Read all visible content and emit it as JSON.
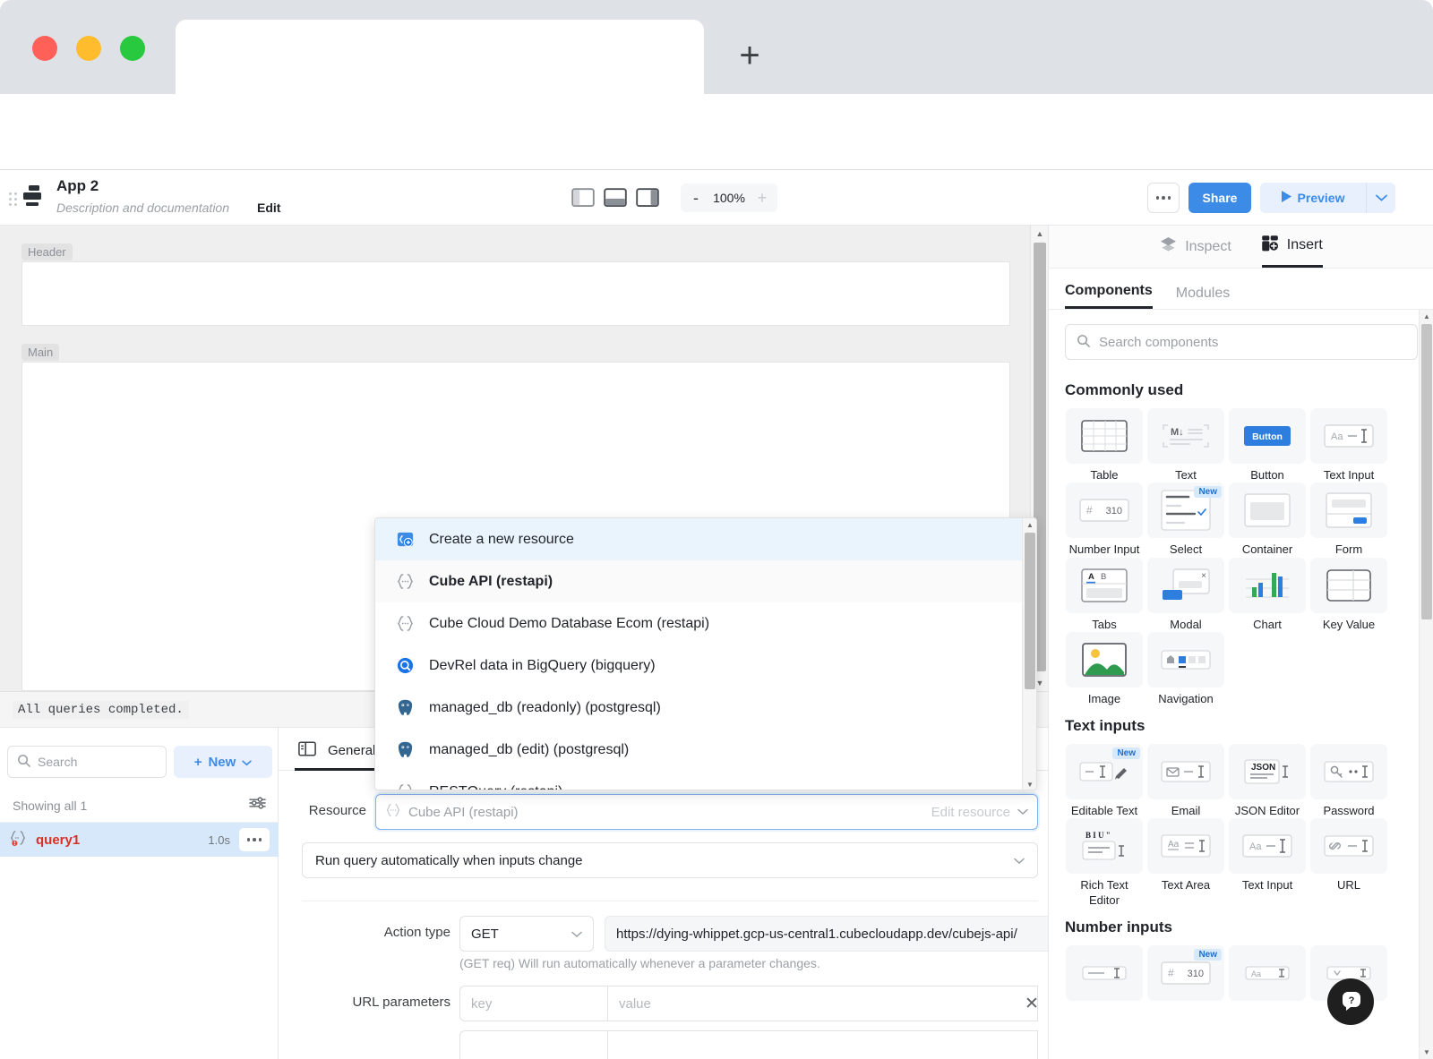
{
  "browser": {
    "new_tab_label": "+",
    "back_icon": "arrow-left-icon",
    "forward_icon": "arrow-right-icon",
    "reload_icon": "reload-icon",
    "menu_icon": "kebab-menu-icon",
    "address_value": "",
    "address_placeholder": ""
  },
  "app_header": {
    "title": "App 2",
    "description": "Description and documentation",
    "edit_label": "Edit",
    "zoom": {
      "minus": "-",
      "level": "100%",
      "plus": "+"
    },
    "layout_buttons": [
      "left-panel-toggle-icon",
      "bottom-panel-toggle-icon",
      "right-panel-toggle-icon"
    ],
    "more_label": "more-options",
    "share_label": "Share",
    "preview_label": "Preview",
    "preview_caret": "chevron-down-icon",
    "accent_blue": "#3c8ce7",
    "accent_blue_light": "#e8f0fd"
  },
  "canvas": {
    "header_label": "Header",
    "main_label": "Main"
  },
  "status": {
    "message": "All queries completed."
  },
  "query_panel": {
    "search_placeholder": "Search",
    "new_label": "New",
    "showing_label": "Showing all 1",
    "filter_icon": "filter-sliders-icon",
    "rows": [
      {
        "name": "query1",
        "duration": "1.0s",
        "icon": "restapi-braces-icon",
        "status": "error"
      }
    ]
  },
  "editor": {
    "tab_label": "General",
    "tab_icon": "panel-icon",
    "resource_label": "Resource",
    "resource_value": "Cube API (restapi)",
    "resource_edit_label": "Edit resource",
    "run_mode_value": "Run query automatically when inputs change",
    "action_type_label": "Action type",
    "action_type_value": "GET",
    "url_value": "https://dying-whippet.gcp-us-central1.cubecloudapp.dev/cubejs-api/",
    "hint": "(GET req) Will run automatically whenever a parameter changes.",
    "url_params_label": "URL parameters",
    "key_placeholder": "key",
    "value_placeholder": "value",
    "remove_icon": "close-icon"
  },
  "resource_dropdown": {
    "items": [
      {
        "label": "Create a new resource",
        "icon": "add-resource-icon",
        "state": "highlighted"
      },
      {
        "label": "Cube API (restapi)",
        "icon": "restapi-braces-icon",
        "state": "selected"
      },
      {
        "label": "Cube Cloud Demo Database Ecom (restapi)",
        "icon": "restapi-braces-icon",
        "state": "normal"
      },
      {
        "label": "DevRel data in BigQuery (bigquery)",
        "icon": "bigquery-icon",
        "state": "normal"
      },
      {
        "label": "managed_db (readonly) (postgresql)",
        "icon": "postgresql-icon",
        "state": "normal"
      },
      {
        "label": "managed_db (edit) (postgresql)",
        "icon": "postgresql-icon",
        "state": "normal"
      },
      {
        "label": "RESTQuery (restapi)",
        "icon": "restapi-braces-icon",
        "state": "normal"
      }
    ]
  },
  "inspector": {
    "tabs": [
      {
        "label": "Inspect",
        "icon": "layers-icon",
        "active": false
      },
      {
        "label": "Insert",
        "icon": "insert-component-icon",
        "active": true
      }
    ],
    "subtabs": [
      {
        "label": "Components",
        "active": true
      },
      {
        "label": "Modules",
        "active": false
      }
    ],
    "search_placeholder": "Search components",
    "groups": [
      {
        "title": "Commonly used",
        "items": [
          {
            "label": "Table",
            "icon": "table-icon",
            "badge": ""
          },
          {
            "label": "Text",
            "icon": "markdown-text-icon",
            "badge": ""
          },
          {
            "label": "Button",
            "icon": "button-icon",
            "badge": ""
          },
          {
            "label": "Text Input",
            "icon": "text-input-icon",
            "badge": ""
          },
          {
            "label": "Number Input",
            "icon": "number-input-icon",
            "badge": ""
          },
          {
            "label": "Select",
            "icon": "select-icon",
            "badge": "New"
          },
          {
            "label": "Container",
            "icon": "container-icon",
            "badge": ""
          },
          {
            "label": "Form",
            "icon": "form-icon",
            "badge": ""
          },
          {
            "label": "Tabs",
            "icon": "tabs-icon",
            "badge": ""
          },
          {
            "label": "Modal",
            "icon": "modal-icon",
            "badge": ""
          },
          {
            "label": "Chart",
            "icon": "chart-icon",
            "badge": ""
          },
          {
            "label": "Key Value",
            "icon": "key-value-icon",
            "badge": ""
          },
          {
            "label": "Image",
            "icon": "image-icon",
            "badge": ""
          },
          {
            "label": "Navigation",
            "icon": "navigation-icon",
            "badge": ""
          }
        ]
      },
      {
        "title": "Text inputs",
        "items": [
          {
            "label": "Editable Text",
            "icon": "editable-text-icon",
            "badge": "New"
          },
          {
            "label": "Email",
            "icon": "email-icon",
            "badge": ""
          },
          {
            "label": "JSON Editor",
            "icon": "json-editor-icon",
            "badge": ""
          },
          {
            "label": "Password",
            "icon": "password-icon",
            "badge": ""
          },
          {
            "label": "Rich Text Editor",
            "icon": "rich-text-editor-icon",
            "badge": ""
          },
          {
            "label": "Text Area",
            "icon": "text-area-icon",
            "badge": ""
          },
          {
            "label": "Text Input",
            "icon": "text-input-icon",
            "badge": ""
          },
          {
            "label": "URL",
            "icon": "url-icon",
            "badge": ""
          }
        ]
      },
      {
        "title": "Number inputs",
        "items": [
          {
            "label": "",
            "icon": "slider-icon",
            "badge": ""
          },
          {
            "label": "",
            "icon": "number-input-icon",
            "badge": "New"
          },
          {
            "label": "",
            "icon": "range-icon",
            "badge": ""
          },
          {
            "label": "",
            "icon": "rating-icon",
            "badge": ""
          }
        ]
      }
    ]
  },
  "help": {
    "icon": "question-mark-icon",
    "label": "?"
  }
}
